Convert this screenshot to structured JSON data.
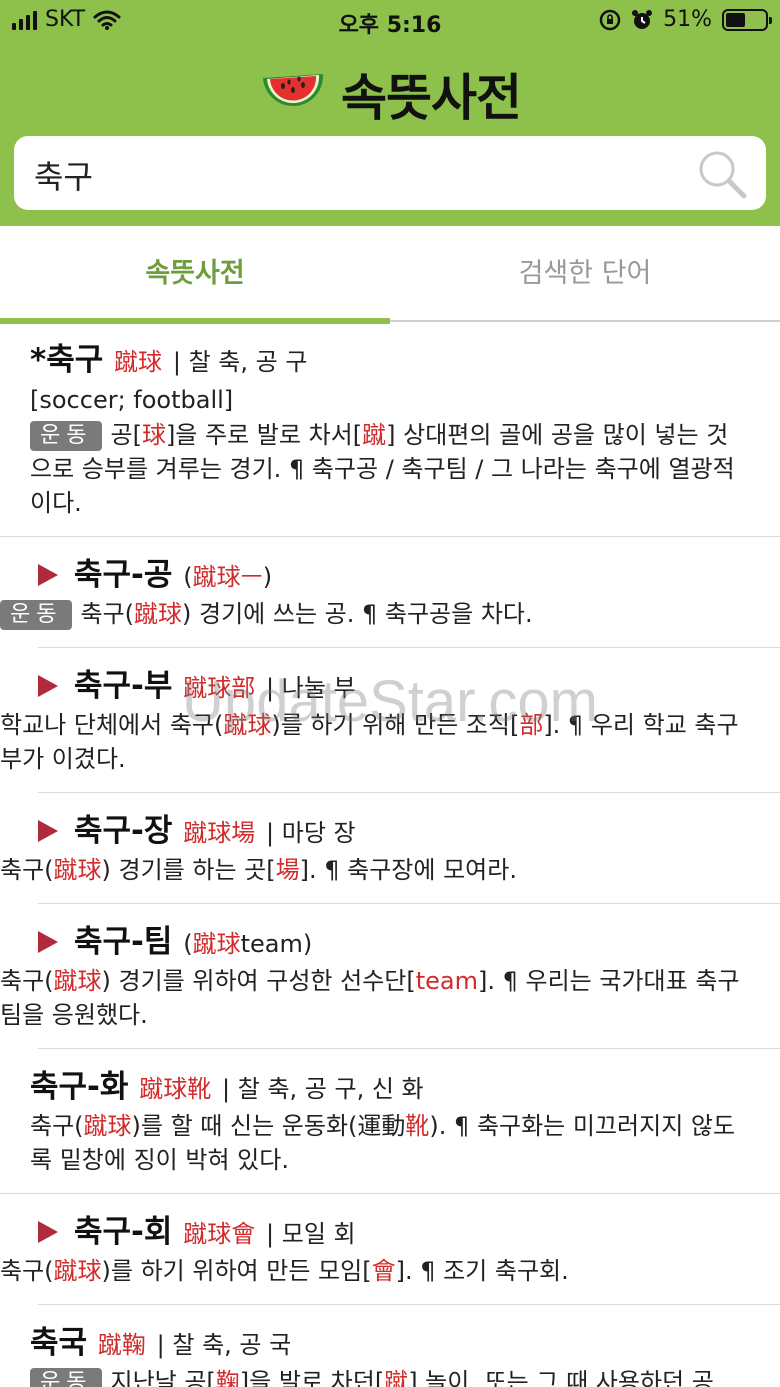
{
  "status_bar": {
    "carrier": "SKT",
    "time": "오후 5:16",
    "battery": "51%",
    "battery_level": 0.51
  },
  "app": {
    "title": "속뜻사전",
    "logo_icon": "watermelon-icon"
  },
  "search": {
    "value": "축구",
    "icon": "search-icon"
  },
  "tabs": [
    {
      "label": "속뜻사전",
      "active": true
    },
    {
      "label": "검색한 단어",
      "active": false
    }
  ],
  "watermark": "UpdateStar.com",
  "entries": [
    {
      "headword": "*축구",
      "hanja": "蹴球",
      "meta": "| 찰 축, 공 구",
      "english": "[soccer; football]",
      "badge": "운동",
      "definition": [
        {
          "t": "공["
        },
        {
          "t": "球",
          "r": true
        },
        {
          "t": "]을 주로 발로 차서["
        },
        {
          "t": "蹴",
          "r": true
        },
        {
          "t": "] 상대편의 골에 공을 많이 넣는 것으로 승부를 겨루는 경기.  ¶ 축구공 / 축구팀 / 그 나라는 축구에 열광적이다."
        }
      ]
    },
    {
      "sub": true,
      "headword": "축구-공",
      "paren_open": "(",
      "hanja": "蹴球ㅡ",
      "paren_close": ")",
      "badge": "운동",
      "definition": [
        {
          "t": "축구("
        },
        {
          "t": "蹴球",
          "r": true
        },
        {
          "t": ") 경기에 쓰는 공.  ¶ 축구공을 차다."
        }
      ]
    },
    {
      "sub": true,
      "headword": "축구-부",
      "hanja": "蹴球部",
      "meta": "| 나눌 부",
      "definition": [
        {
          "t": "학교나 단체에서 축구("
        },
        {
          "t": "蹴球",
          "r": true
        },
        {
          "t": ")를 하기 위해 만든 조직["
        },
        {
          "t": "部",
          "r": true
        },
        {
          "t": "].  ¶ 우리 학교 축구부가 이겼다."
        }
      ]
    },
    {
      "sub": true,
      "headword": "축구-장",
      "hanja": "蹴球場",
      "meta": "| 마당 장",
      "definition": [
        {
          "t": "축구("
        },
        {
          "t": "蹴球",
          "r": true
        },
        {
          "t": ") 경기를 하는 곳["
        },
        {
          "t": "場",
          "r": true
        },
        {
          "t": "].  ¶ 축구장에 모여라."
        }
      ]
    },
    {
      "sub": true,
      "headword": "축구-팀",
      "paren_open": "(",
      "hanja": "蹴球",
      "tail": "team",
      "paren_close": ")",
      "definition": [
        {
          "t": "축구("
        },
        {
          "t": "蹴球",
          "r": true
        },
        {
          "t": ") 경기를 위하여 구성한 선수단["
        },
        {
          "t": "team",
          "r": true
        },
        {
          "t": "].  ¶ 우리는 국가대표 축구팀을 응원했다."
        }
      ]
    },
    {
      "headword": "축구-화",
      "hanja": "蹴球靴",
      "meta": "| 찰 축, 공 구, 신 화",
      "definition": [
        {
          "t": "축구("
        },
        {
          "t": "蹴球",
          "r": true
        },
        {
          "t": ")를 할 때 신는 운동화(運動"
        },
        {
          "t": "靴",
          "r": true
        },
        {
          "t": ").  ¶ 축구화는 미끄러지지 않도록 밑창에 징이 박혀 있다."
        }
      ]
    },
    {
      "sub": true,
      "headword": "축구-회",
      "hanja": "蹴球會",
      "meta": "| 모일 회",
      "definition": [
        {
          "t": "축구("
        },
        {
          "t": "蹴球",
          "r": true
        },
        {
          "t": ")를 하기 위하여 만든 모임["
        },
        {
          "t": "會",
          "r": true
        },
        {
          "t": "].  ¶ 조기 축구회."
        }
      ]
    },
    {
      "headword": "축국",
      "hanja": "蹴鞠",
      "meta": "| 찰 축, 공 국",
      "badge": "운동",
      "definition": [
        {
          "t": "지난날 공["
        },
        {
          "t": "鞠",
          "r": true
        },
        {
          "t": "]을 발로 차던["
        },
        {
          "t": "蹴",
          "r": true
        },
        {
          "t": "] 놀이. 또는 그 때 사용하던 공."
        }
      ]
    }
  ]
}
